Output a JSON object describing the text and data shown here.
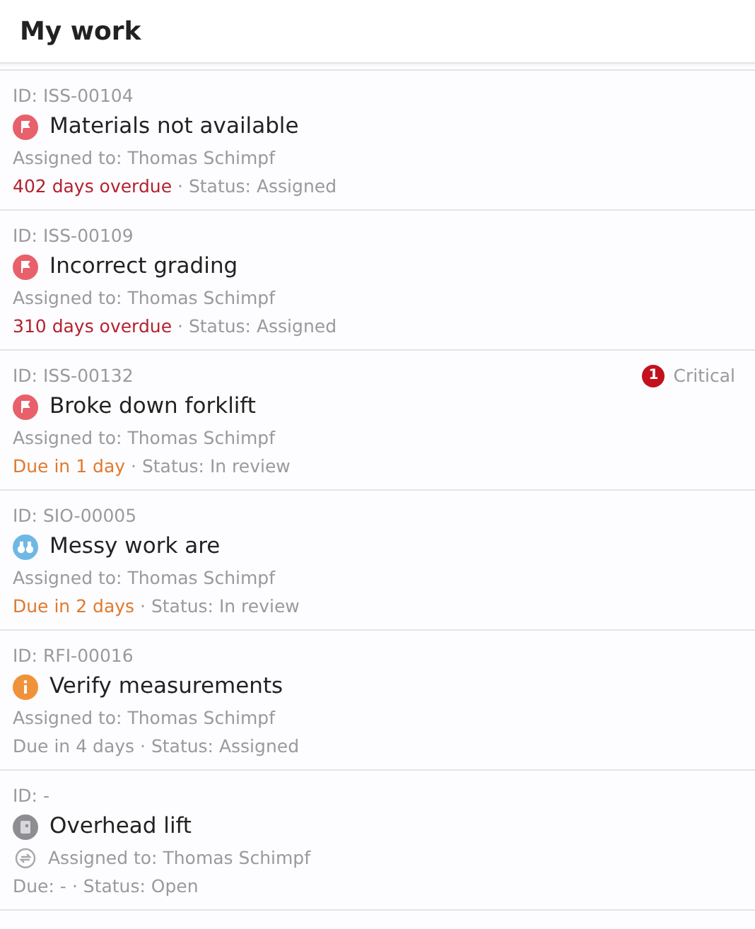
{
  "header": {
    "title": "My work"
  },
  "items": [
    {
      "id": "ID: ISS-00104",
      "kind": "issue",
      "title": "Materials not available",
      "assigned": "Assigned to: Thomas Schimpf",
      "recurring": false,
      "due": "402 days overdue",
      "color": "#b3222f",
      "status": "· Status: Assigned"
    },
    {
      "id": "ID: ISS-00109",
      "kind": "issue",
      "title": "Incorrect grading",
      "assigned": "Assigned to: Thomas Schimpf",
      "recurring": false,
      "due": "310 days overdue",
      "color": "#b3222f",
      "status": "· Status: Assigned"
    },
    {
      "id": "ID: ISS-00132",
      "kind": "issue",
      "title": "Broke down forklift",
      "assigned": "Assigned to: Thomas Schimpf",
      "recurring": false,
      "due": "Due in 1 day",
      "color": "#e07a2e",
      "status": "· Status: In review",
      "priority": {
        "number": "1",
        "label": "Critical"
      }
    },
    {
      "id": "ID: SIO-00005",
      "kind": "observation",
      "title": "Messy work are",
      "assigned": "Assigned to: Thomas Schimpf",
      "recurring": false,
      "due": "Due in 2 days",
      "color": "#e07a2e",
      "status": "· Status: In review"
    },
    {
      "id": "ID: RFI-00016",
      "kind": "rfi",
      "title": "Verify measurements",
      "assigned": "Assigned to: Thomas Schimpf",
      "recurring": false,
      "due": "Due in 4 days",
      "color": "#9a9a9e",
      "status": "· Status: Assigned"
    },
    {
      "id": "ID: -",
      "kind": "task",
      "title": "Overhead lift",
      "assigned": "Assigned to: Thomas Schimpf",
      "recurring": true,
      "due": "Due: -",
      "color": "#9a9a9e",
      "status": "· Status: Open"
    }
  ]
}
